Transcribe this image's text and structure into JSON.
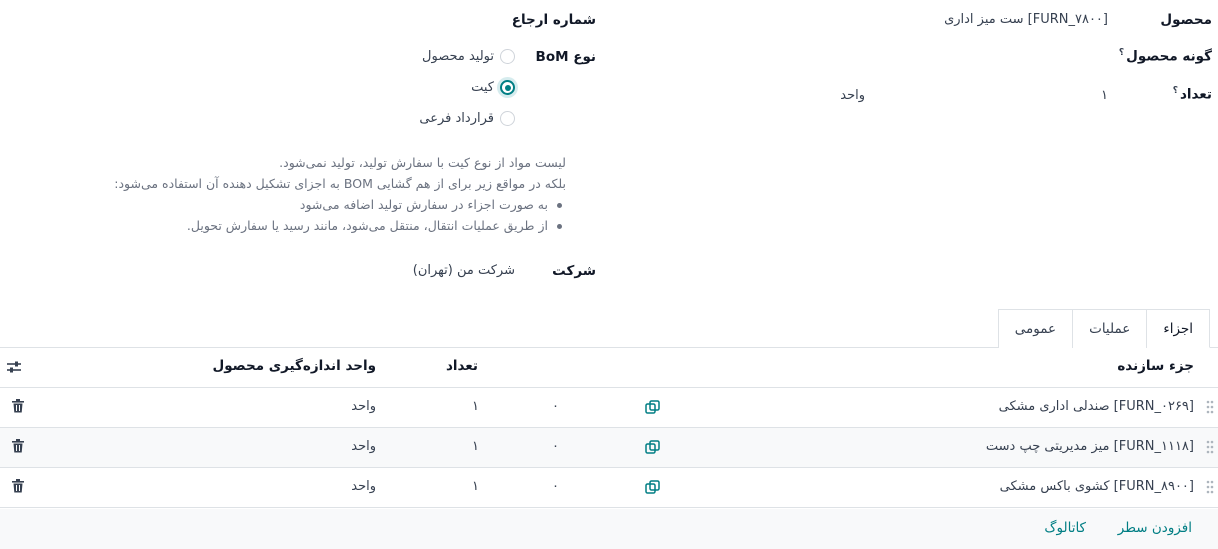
{
  "form": {
    "product_label": "محصول",
    "product_value": "[FURN_۷۸۰۰] ست میز اداری",
    "product_variant_label": "گونه محصول",
    "help_mark": "؟",
    "quantity_label": "تعداد",
    "quantity_value": "۱",
    "quantity_uom": "واحد",
    "reference_label": "شماره ارجاع",
    "bom_type_label": "نوع BoM",
    "bom_type_options": [
      {
        "label": "تولید محصول",
        "checked": false
      },
      {
        "label": "کیت",
        "checked": true
      },
      {
        "label": "قرارداد فرعی",
        "checked": false
      }
    ],
    "kit_note": {
      "line1": "لیست مواد از نوع کیت با سفارش تولید، تولید نمی‌شود.",
      "line2": "بلکه در مواقع زیر برای از هم گشایی BOM به اجزای تشکیل دهنده آن استفاده می‌شود:",
      "bullets": [
        "به صورت اجزاء در سفارش تولید اضافه می‌شود",
        "از طریق عملیات انتقال، منتقل می‌شود، مانند رسید یا سفارش تحویل."
      ]
    },
    "company_label": "شرکت",
    "company_value": "شرکت من (تهران)"
  },
  "tabs": [
    {
      "label": "اجزاء",
      "active": true
    },
    {
      "label": "عملیات",
      "active": false
    },
    {
      "label": "عمومی",
      "active": false
    }
  ],
  "table": {
    "headers": {
      "component": "جزء سازنده",
      "quantity": "تعداد",
      "uom": "واحد اندازه‌گیری محصول"
    },
    "rows": [
      {
        "component": "[FURN_۰۲۶۹] صندلی اداری مشکی",
        "extra": "۰",
        "quantity": "۱",
        "uom": "واحد"
      },
      {
        "component": "[FURN_۱۱۱۸] میز مدیریتی چپ دست",
        "extra": "۰",
        "quantity": "۱",
        "uom": "واحد"
      },
      {
        "component": "[FURN_۸۹۰۰] کشوی باکس مشکی",
        "extra": "۰",
        "quantity": "۱",
        "uom": "واحد"
      }
    ],
    "add_line": "افزودن سطر",
    "catalog": "کاتالوگ"
  },
  "colors": {
    "accent": "#017e84"
  },
  "icons": {
    "settings": "sliders-icon",
    "drag": "drag-handle-icon",
    "copy": "copy-icon",
    "delete": "trash-icon"
  }
}
